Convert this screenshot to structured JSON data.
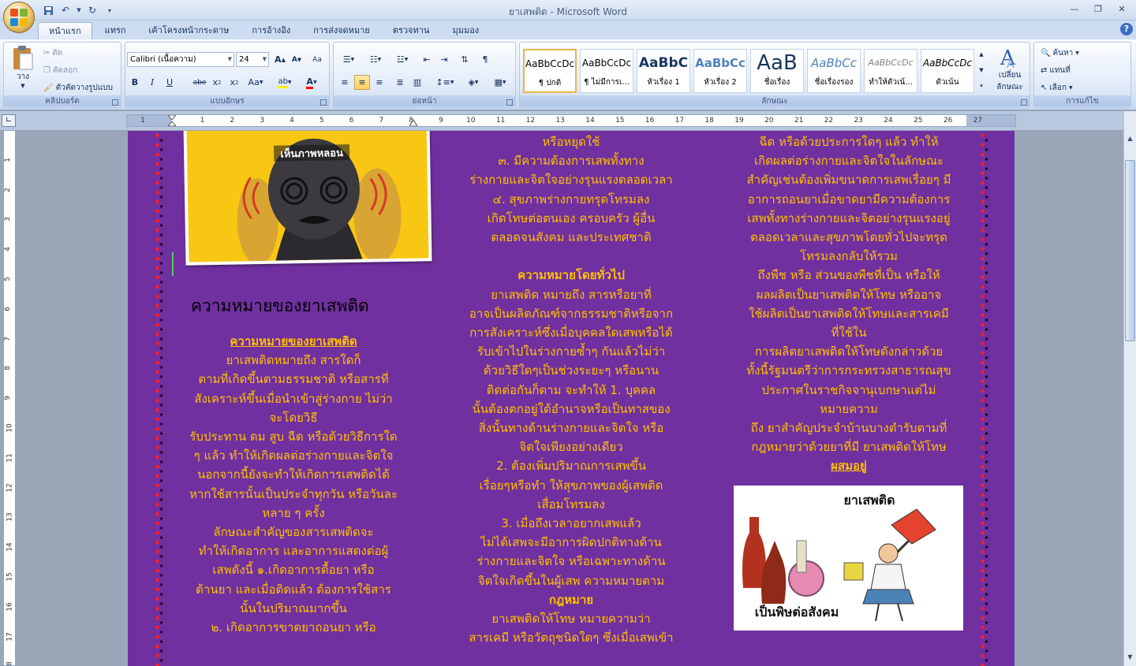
{
  "window": {
    "title": "ยาเสพติด - Microsoft Word"
  },
  "tabs": [
    "หน้าแรก",
    "แทรก",
    "เค้าโครงหน้ากระดาษ",
    "การอ้างอิง",
    "การส่งจดหมาย",
    "ตรวจทาน",
    "มุมมอง"
  ],
  "ribbon": {
    "clipboard": {
      "label": "คลิปบอร์ด",
      "paste": "วาง",
      "cut": "ตัด",
      "copy": "คัดลอก",
      "format_painter": "ตัวคัดวางรูปแบบ"
    },
    "font": {
      "label": "แบบอักษร",
      "family": "Calibri (เนื้อความ)",
      "size": "24"
    },
    "paragraph": {
      "label": "ย่อหน้า"
    },
    "styles": {
      "label": "ลักษณะ",
      "change": "เปลี่ยน",
      "change2": "ลักษณะ",
      "items": [
        {
          "sample": "AaBbCcDc",
          "name": "¶ ปกติ"
        },
        {
          "sample": "AaBbCcDc",
          "name": "¶ ไม่มีการเ..."
        },
        {
          "sample": "AaBbC",
          "name": "หัวเรื่อง 1"
        },
        {
          "sample": "AaBbCc",
          "name": "หัวเรื่อง 2"
        },
        {
          "sample": "AaB",
          "name": "ชื่อเรื่อง"
        },
        {
          "sample": "AaBbCc",
          "name": "ชื่อเรื่องรอง"
        },
        {
          "sample": "AaBbCcDc",
          "name": "ทำให้ตัวเน้..."
        },
        {
          "sample": "AaBbCcDc",
          "name": "ตัวเน้น"
        }
      ]
    },
    "editing": {
      "label": "การแก้ไข",
      "find": "ค้นหา",
      "replace": "แทนที่",
      "select": "เลือก"
    }
  },
  "document": {
    "col1": {
      "image_caption": "เห็นภาพหลอน",
      "heading": "ความหมายของยาเสพติด",
      "lines": [
        {
          "text": "ความหมายของยาเสพติด",
          "style": "bu"
        },
        {
          "text": "ยาเสพติดหมายถึง สารใดก็",
          "style": "lead"
        },
        {
          "text": "ตามที่เกิดขึ้นตามธรรมชาติ หรือสารที่",
          "style": ""
        },
        {
          "text": "สังเคราะห์ขึ้นเมื่อนำเข้าสู่ร่างกาย ไม่ว่า",
          "style": ""
        },
        {
          "text": "จะโดยวิธี",
          "style": ""
        },
        {
          "text": "รับประทาน ดม สูบ ฉีด หรือด้วยวิธีการใด",
          "style": ""
        },
        {
          "text": "ๆ แล้ว ทำให้เกิดผลต่อร่างกายและจิตใจ",
          "style": ""
        },
        {
          "text": "นอกจากนี้ยังจะทำให้เกิดการเสพติดได้",
          "style": ""
        },
        {
          "text": "หากใช้สารนั้นเป็นประจำทุกวัน หรือวันละ",
          "style": ""
        },
        {
          "text": "หลาย ๆ ครั้ง",
          "style": ""
        },
        {
          "text": "ลักษณะสำคัญของสารเสพติดจะ",
          "style": ""
        },
        {
          "text": "ทำให้เกิดอาการ และอาการแสดงต่อผู้",
          "style": ""
        },
        {
          "text": "เสพดังนี้           ๑.เกิดอาการดื้อยา หรือ",
          "style": ""
        },
        {
          "text": "ต้านยา และเมื่อติดแล้ว ต้องการใช้สาร",
          "style": ""
        },
        {
          "text": "นั้นในปริมาณมากขึ้น",
          "style": ""
        },
        {
          "text": "๒. เกิดอาการขาดยาถอนยา หรือ",
          "style": ""
        }
      ]
    },
    "col2": {
      "lines": [
        "หรือหยุดใช้",
        "๓. มีความต้องการเสพทั้งทาง",
        "ร่างกายและจิตใจอย่างรุนแรงตลอดเวลา",
        "๔. สุขภาพร่างกายทรุดโทรมลง",
        "เกิดโทษต่อตนเอง ครอบครัว ผู้อื่น",
        "ตลอดจนสังคม และประเทศชาติ",
        "",
        "ความหมายโดยทั่วไป",
        "ยาเสพติด หมายถึง สารหรือยาที่",
        "อาจเป็นผลิตภัณฑ์จากธรรมชาติหรือจาก",
        "การสังเคราะห์ซึ่งเมื่อบุคคลใดเสพหรือได้",
        "รับเข้าไปในร่างกายซ้ำๆ กันแล้วไม่ว่า",
        "ด้วยวิธีใดๆเป็นช่วงระยะๆ หรือนาน",
        "ติดต่อกันก็ตาม จะทำให้          1. บุคคล",
        "นั้นต้องตกอยู่ใต้อำนาจหรือเป็นทาสของ",
        "สิ่งนั้นทางด้านร่างกายและจิตใจ หรือ",
        "จิตใจเพียงอย่างเดียว",
        "2. ต้องเพิ่มปริมาณการเสพขึ้น",
        "เรื่อยๆหรือทำ ให้สุขภาพของผู้เสพติด",
        "เสื่อมโทรมลง",
        "3. เมื่อถึงเวลาอยากเสพแล้ว",
        "ไม่ได้เสพจะมีอาการผิดปกติทางด้าน",
        "ร่างกายและจิตใจ หรือเฉพาะทางด้าน",
        "จิตใจเกิดขึ้นในผู้เสพ  ความหมายตาม",
        "กฎหมาย",
        "ยาเสพติดให้โทษ หมายความว่า",
        "สารเคมี หรือวัตถุชนิดใดๆ ซึ่งเมื่อเสพเข้า"
      ]
    },
    "col3": {
      "lines": [
        "ฉีด หรือด้วยประการใดๆ แล้ว ทำให้",
        "เกิดผลต่อร่างกายและจิตใจในลักษณะ",
        "สำคัญเช่นต้องเพิ่มขนาดการเสพเรื่อยๆ มี",
        "อาการถอนยาเมื่อขาดยามีความต้องการ",
        "เสพทั้งทางร่างกายและจิตอย่างรุนแรงอยู่",
        "ตลอดเวลาและสุขภาพโดยทั่วไปจะทรุด",
        "โทรมลงกลับให้รวม",
        "ถึงพืช หรือ ส่วนของพืชที่เป็น หรือให้",
        "ผลผลิตเป็นยาเสพติดให้โทษ หรืออาจ",
        "ใช้ผลิตเป็นยาเสพติดให้โทษและสารเคมี",
        "ที่ใช้ใน",
        "การผลิตยาเสพติดให้โทษดังกล่าวด้วย",
        "ทั้งนี้รัฐมนตรีว่าการกระทรวงสาธารณสุข",
        "ประกาศในราชกิจจานุเบกษาแต่ไม่",
        "หมายความ",
        "ถึง ยาสำคัญประจำบ้านบางตำรับตามที่",
        "กฎหมายว่าด้วยยาที่มี ยาเสพติดให้โทษ",
        "ผสมอยู่"
      ],
      "image_title": "ยาเสพติด",
      "image_caption": "เป็นพิษต่อสังคม"
    }
  },
  "colors": {
    "page": "#7030a0",
    "text": "#ffc000",
    "border_dots": "#ff1f1f"
  }
}
